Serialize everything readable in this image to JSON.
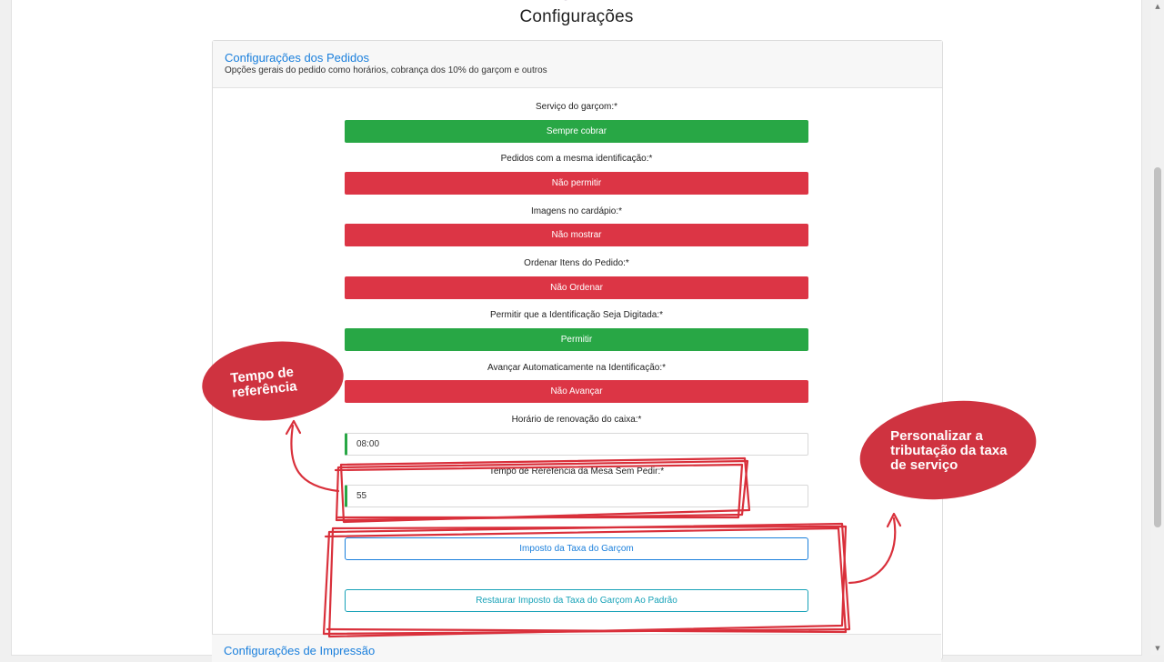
{
  "page": {
    "title": "Configurações"
  },
  "orders_card": {
    "title": "Configurações dos Pedidos",
    "subtitle": "Opções gerais do pedido como horários, cobrança dos 10% do garçom e outros"
  },
  "fields": {
    "waiter_service": {
      "label": "Serviço do garçom:*",
      "value": "Sempre cobrar",
      "color": "#28a745"
    },
    "same_identification": {
      "label": "Pedidos com a mesma identificação:*",
      "value": "Não permitir",
      "color": "#dc3545"
    },
    "menu_images": {
      "label": "Imagens no cardápio:*",
      "value": "Não mostrar",
      "color": "#dc3545"
    },
    "sort_items": {
      "label": "Ordenar Itens do Pedido:*",
      "value": "Não Ordenar",
      "color": "#dc3545"
    },
    "typed_identification": {
      "label": "Permitir que a Identificação Seja Digitada:*",
      "value": "Permitir",
      "color": "#28a745"
    },
    "auto_advance": {
      "label": "Avançar Automaticamente na Identificação:*",
      "value": "Não Avançar",
      "color": "#dc3545"
    },
    "cash_renewal_time": {
      "label": "Horário de renovação do caixa:*",
      "value": "08:00"
    },
    "table_reference_time": {
      "label": "Tempo de Rerefência da Mesa Sem Pedir:*",
      "value": "55"
    }
  },
  "buttons": {
    "waiter_tax": "Imposto da Taxa do Garçom",
    "restore_waiter_tax": "Restaurar Imposto da Taxa do Garçom Ao Padrão"
  },
  "print_card": {
    "title": "Configurações de Impressão"
  },
  "annotations": {
    "reference_time": "Tempo de referência",
    "service_tax": "Personalizar a tributação da taxa de serviço"
  },
  "colors": {
    "accent": "#1a7fdc",
    "success": "#28a745",
    "danger": "#dc3545",
    "annotation": "#cf3340",
    "info": "#17a2b8"
  }
}
